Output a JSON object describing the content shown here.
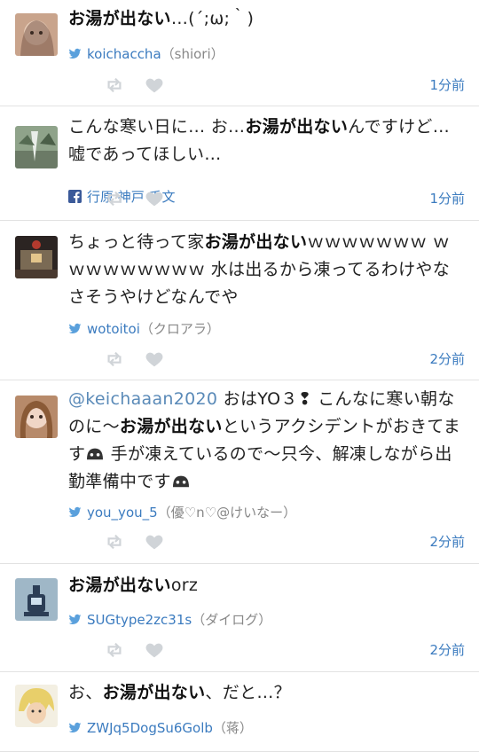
{
  "posts": [
    {
      "text": [
        {
          "t": "お湯が出ない",
          "hl": true
        },
        {
          "t": "…(´;ω;｀)"
        }
      ],
      "user": "koichaccha",
      "display": "（shiori）",
      "source": "twitter",
      "time": "1分前"
    },
    {
      "text": [
        {
          "t": "こんな寒い日に… お…"
        },
        {
          "t": "お湯が出ない",
          "hl": true
        },
        {
          "t": "んですけど… 嘘であってほしい…"
        }
      ],
      "user": "行原 神戸 千文",
      "display": "",
      "source": "facebook",
      "time": "1分前"
    },
    {
      "text": [
        {
          "t": "ちょっと待って家"
        },
        {
          "t": "お湯が出ない",
          "hl": true
        },
        {
          "t": "ｗｗｗｗｗｗｗ ｗｗｗｗｗｗｗｗｗ 水は出るから凍ってるわけやなさそうやけどなんでや"
        }
      ],
      "user": "wotoitoi",
      "display": "（クロアラ）",
      "source": "twitter",
      "time": "2分前"
    },
    {
      "text": [
        {
          "t": "@keichaaan2020",
          "mention": true
        },
        {
          "t": " おはYO３❢ こんなに寒い朝なのに〜"
        },
        {
          "t": "お湯が出ない",
          "hl": true
        },
        {
          "t": "というアクシデントがおきてます"
        },
        {
          "t": "☁",
          "emoji": true
        },
        {
          "t": " 手が凍えているので〜只今、解凍しながら出勤準備中です"
        },
        {
          "t": "☁",
          "emoji": true
        }
      ],
      "user": "you_you_5",
      "display": "（優♡n♡@けいなー）",
      "source": "twitter",
      "time": "2分前"
    },
    {
      "text": [
        {
          "t": "お湯が出ない",
          "hl": true
        },
        {
          "t": "orz"
        }
      ],
      "user": "SUGtype2zc31s",
      "display": "（ダイログ）",
      "source": "twitter",
      "time": "2分前"
    },
    {
      "text": [
        {
          "t": "お、"
        },
        {
          "t": "お湯が出ない",
          "hl": true
        },
        {
          "t": "、だと…？"
        }
      ],
      "user": "ZWJq5DogSu6Golb",
      "display": "（蒋）",
      "source": "twitter",
      "time": ""
    }
  ],
  "icons": {
    "retweet": "retweet-icon",
    "favorite": "heart-icon",
    "twitter": "twitter-bird-icon",
    "facebook": "facebook-icon"
  },
  "colors": {
    "link": "#3b7bbf",
    "muted_icon": "#d0d4d8",
    "divider": "#e2e2e2"
  }
}
